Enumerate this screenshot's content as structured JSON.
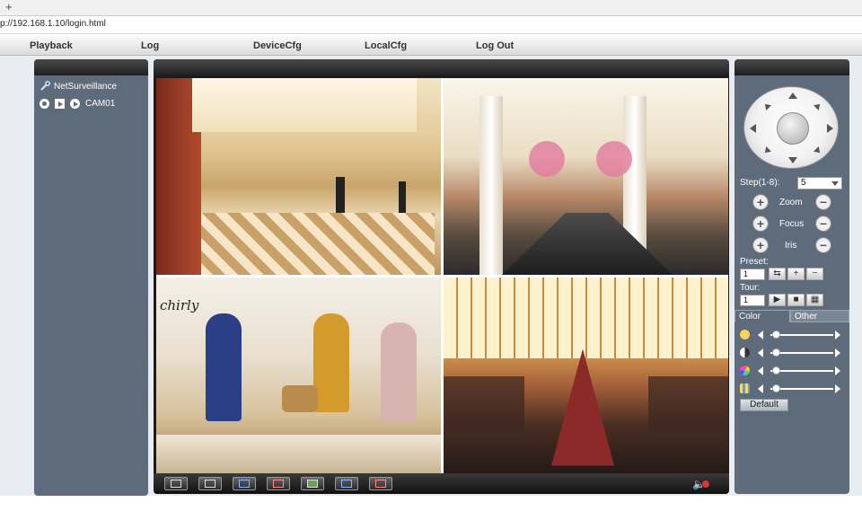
{
  "browser": {
    "new_tab_symbol": "+",
    "url": "p://192.168.1.10/login.html"
  },
  "menu": {
    "items": [
      {
        "label": "Playback"
      },
      {
        "label": "Log"
      },
      {
        "label": "DeviceCfg"
      },
      {
        "label": "LocalCfg"
      },
      {
        "label": "Log Out"
      }
    ]
  },
  "left_panel": {
    "root_label": "NetSurveillance",
    "camera_label": "CAM01"
  },
  "video": {
    "cells": [
      {
        "name": "video-cell-1"
      },
      {
        "name": "video-cell-2"
      },
      {
        "name": "video-cell-3"
      },
      {
        "name": "video-cell-4"
      }
    ],
    "store_sign": "chirly"
  },
  "toolbar": {
    "buttons": [
      {
        "icon": "fullscreen-icon"
      },
      {
        "icon": "single-view-icon"
      },
      {
        "icon": "record-start-icon"
      },
      {
        "icon": "record-stop-icon"
      },
      {
        "icon": "snapshot-icon"
      },
      {
        "icon": "talk-start-icon"
      },
      {
        "icon": "talk-stop-icon"
      }
    ],
    "volume_icon": "speaker-muted-icon"
  },
  "control": {
    "step_label": "Step(1-8):",
    "step_value": "5",
    "zoom_label": "Zoom",
    "focus_label": "Focus",
    "iris_label": "Iris",
    "preset_label": "Preset:",
    "preset_value": "1",
    "tour_label": "Tour:",
    "tour_value": "1",
    "plus": "+",
    "minus": "−",
    "tabs": {
      "color": "Color",
      "other": "Other"
    },
    "default_label": "Default",
    "sliders": [
      {
        "icon": "brightness-icon"
      },
      {
        "icon": "contrast-icon"
      },
      {
        "icon": "saturation-icon"
      },
      {
        "icon": "hue-icon"
      }
    ]
  }
}
